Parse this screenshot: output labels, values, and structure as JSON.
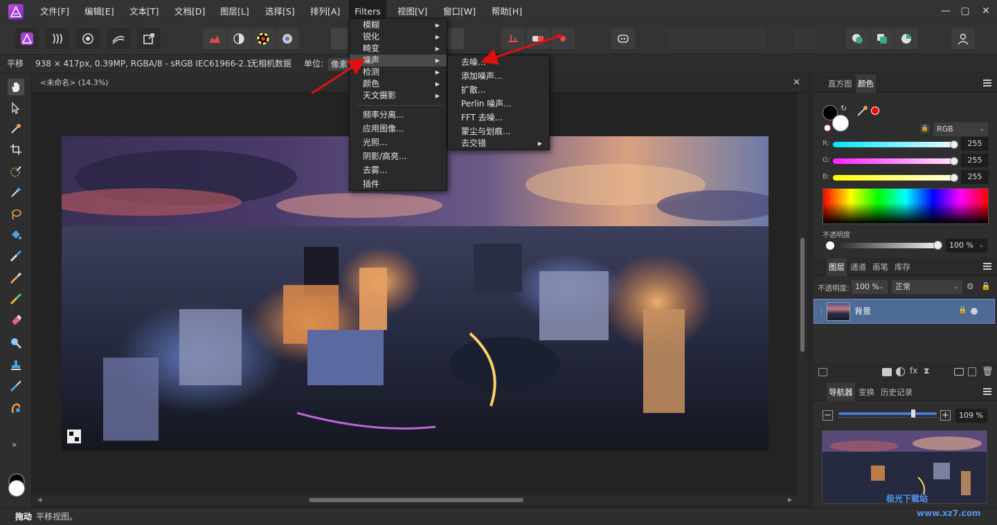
{
  "menubar": {
    "items": [
      "文件[F]",
      "编辑[E]",
      "文本[T]",
      "文档[D]",
      "图层[L]",
      "选择[S]",
      "排列[A]",
      "Filters",
      "视图[V]",
      "窗口[W]",
      "帮助[H]"
    ],
    "window_controls": [
      "—",
      "▢",
      "✕"
    ]
  },
  "context": {
    "tool": "平移",
    "doc_info": "938 × 417px, 0.39MP, RGBA/8 - sRGB IEC61966-2.1",
    "camera": "无相机数据",
    "units_label": "单位:",
    "units_value": "像素"
  },
  "document": {
    "title": "<未命名> (14.3%)",
    "close": "✕"
  },
  "tools": [
    "hand",
    "move",
    "color-picker",
    "crop",
    "selection-brush",
    "flood-select",
    "freehand-select",
    "flood-fill",
    "paint-brush",
    "retouch",
    "clone",
    "erase",
    "dodge",
    "stamp",
    "smudge",
    "mesh-warp"
  ],
  "more_tools": "»",
  "filters_menu": {
    "items": [
      "模糊",
      "锐化",
      "畸变",
      "噪声",
      "检测",
      "颜色",
      "天文摄影"
    ],
    "items2": [
      "频率分离...",
      "应用图像...",
      "光照...",
      "阴影/高亮...",
      "去雾...",
      "插件"
    ],
    "highlighted": "噪声"
  },
  "noise_menu": {
    "items": [
      "去噪...",
      "添加噪声...",
      "扩散...",
      "Perlin 噪声...",
      "FFT 去噪...",
      "蒙尘与划痕...",
      "去交错"
    ]
  },
  "color_panel": {
    "tabs": [
      "直方图",
      "颜色"
    ],
    "active_tab": "颜色",
    "model": "RGB",
    "channels": [
      {
        "label": "R:",
        "value": "255",
        "color": "#00e5ff"
      },
      {
        "label": "G:",
        "value": "255",
        "color": "#ff20ff"
      },
      {
        "label": "B:",
        "value": "255",
        "color": "#ffff00"
      }
    ],
    "opacity_label": "不透明度",
    "opacity_value": "100 %"
  },
  "layers_panel": {
    "tabs": [
      "图层",
      "通道",
      "画笔",
      "库存"
    ],
    "opacity_label": "不透明度:",
    "opacity_value": "100 %",
    "blend_mode": "正常",
    "layer_name": "背景"
  },
  "navigator_panel": {
    "tabs": [
      "导航器",
      "变换",
      "历史记录"
    ],
    "zoom_value": "109 %",
    "zoom_level": 0.76
  },
  "status": {
    "strong": "拖动",
    "text": "平移视图。"
  },
  "watermark": {
    "text": "极光下载站",
    "url": "www.xz7.com"
  }
}
